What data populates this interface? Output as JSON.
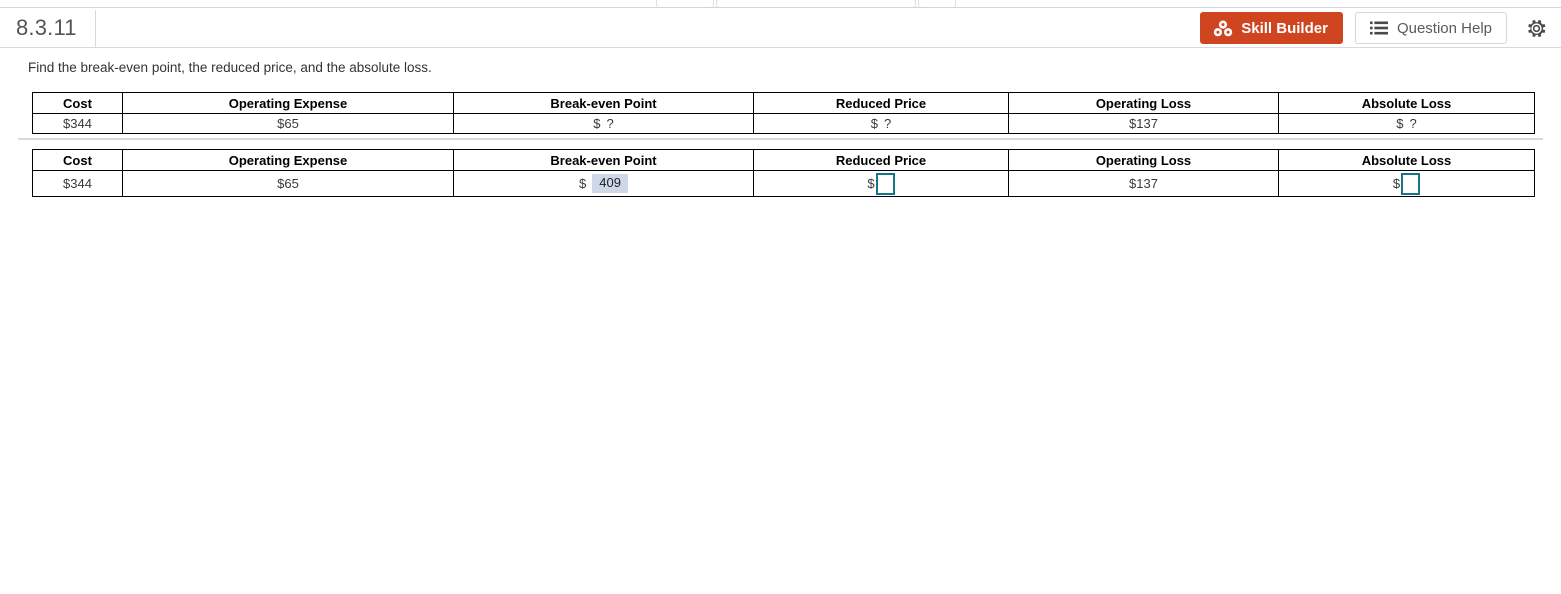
{
  "header": {
    "exercise_id": "8.3.11",
    "skill_builder": {
      "label": "Skill Builder",
      "icon": "cubes-icon",
      "color": "#cf4520"
    },
    "question_help": {
      "label": "Question Help",
      "icon": "list-icon"
    },
    "settings": {
      "icon": "gear-icon"
    }
  },
  "prompt": "Find the break-even point, the reduced price, and the absolute loss.",
  "tables": [
    {
      "name": "given-values-table",
      "headers": [
        "Cost",
        "Operating Expense",
        "Break-even Point",
        "Reduced Price",
        "Operating Loss",
        "Absolute Loss"
      ],
      "cells": [
        {
          "type": "text",
          "value": "$344"
        },
        {
          "type": "text",
          "value": "$65"
        },
        {
          "type": "unknown",
          "dollar": "$",
          "value": "?"
        },
        {
          "type": "unknown",
          "dollar": "$",
          "value": "?"
        },
        {
          "type": "text",
          "value": "$137"
        },
        {
          "type": "unknown",
          "dollar": "$",
          "value": "?"
        }
      ]
    },
    {
      "name": "answer-table",
      "headers": [
        "Cost",
        "Operating Expense",
        "Break-even Point",
        "Reduced Price",
        "Operating Loss",
        "Absolute Loss"
      ],
      "cells": [
        {
          "type": "text",
          "value": "$344"
        },
        {
          "type": "text",
          "value": "$65"
        },
        {
          "type": "filled",
          "dollar": "$",
          "value": "409"
        },
        {
          "type": "input",
          "dollar": "$",
          "value": "",
          "placeholder": ""
        },
        {
          "type": "text",
          "value": "$137"
        },
        {
          "type": "input",
          "dollar": "$",
          "value": "",
          "placeholder": ""
        }
      ]
    }
  ],
  "colors": {
    "accent_orange": "#cf4520",
    "input_border_teal": "#1a7489",
    "filled_answer_bg": "#ced8e8",
    "table_border": "#000000"
  }
}
